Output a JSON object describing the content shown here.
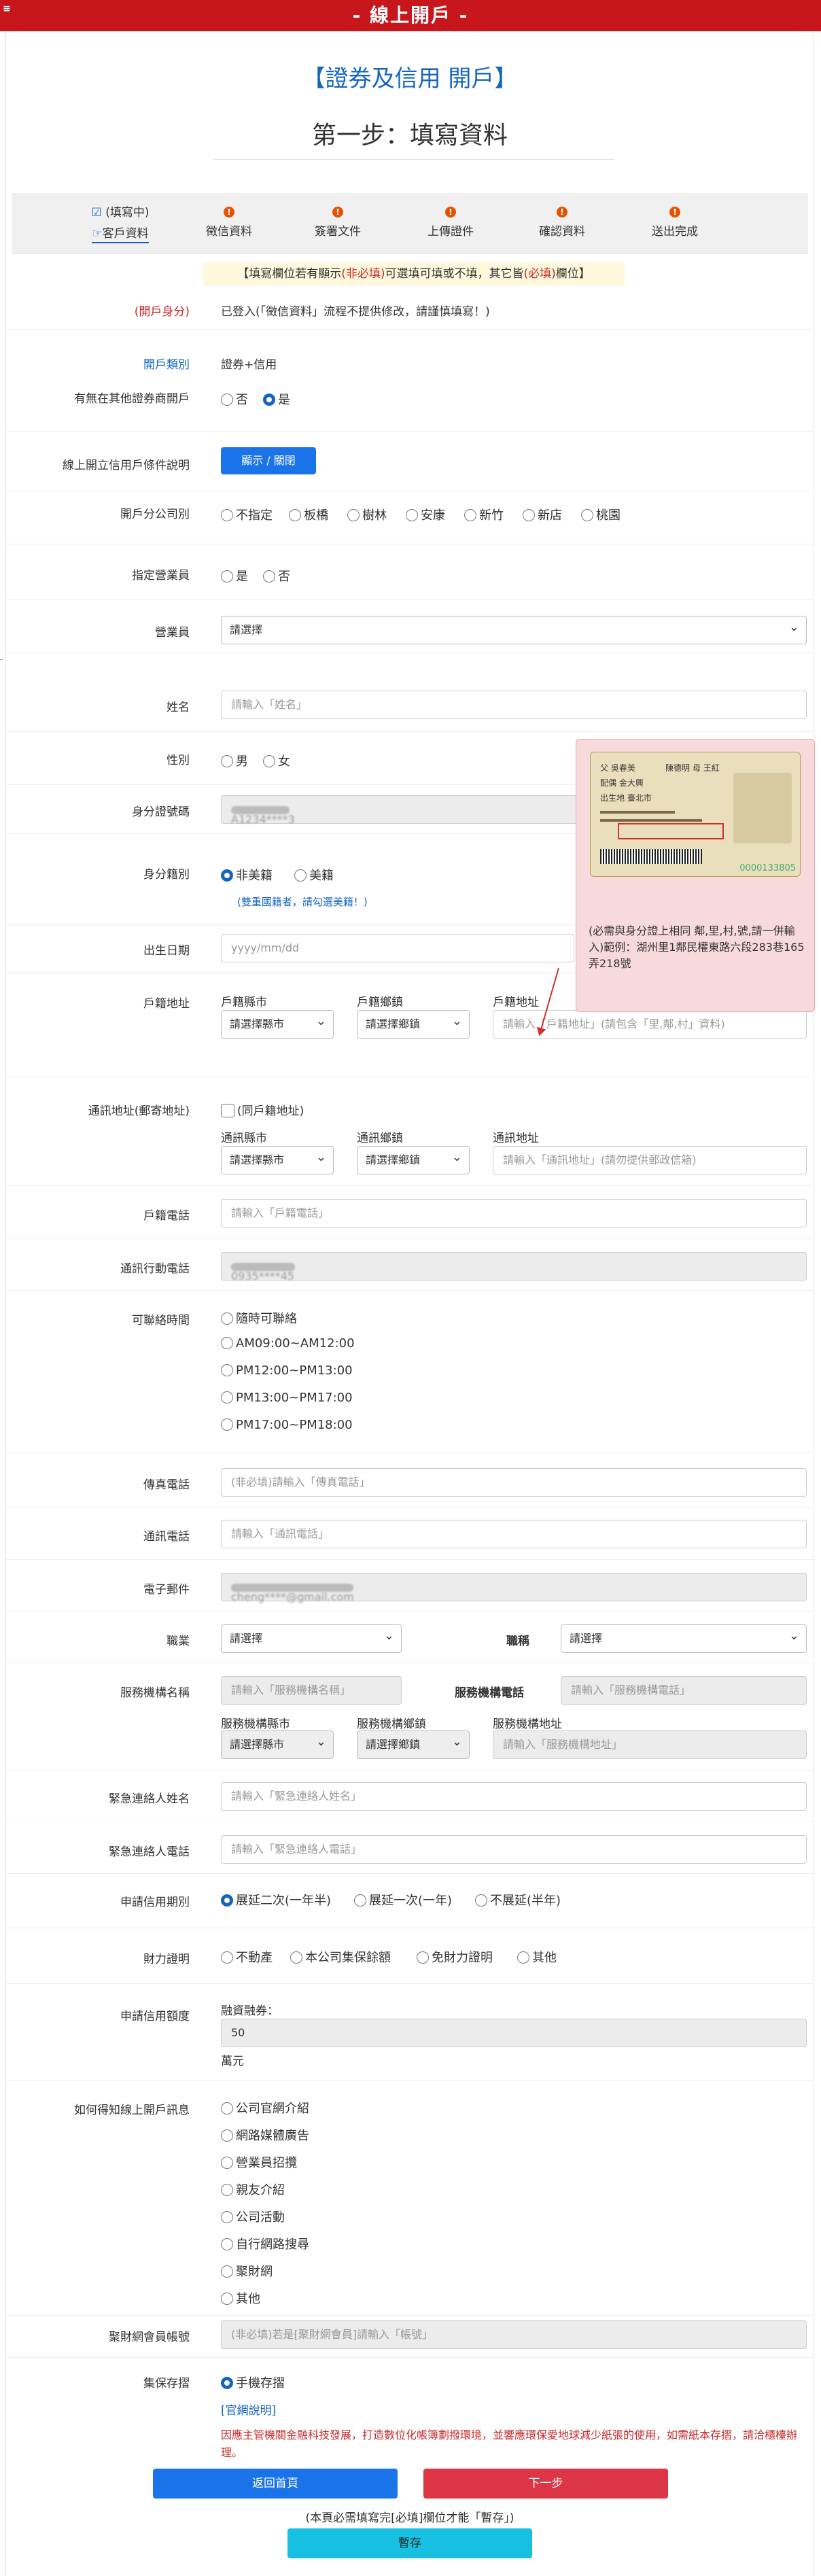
{
  "header": {
    "menu_icon": "≡",
    "title": "- 線上開戶 -"
  },
  "heading": {
    "title": "【證券及信用 開戶】",
    "step_title": "第一步：填寫資料"
  },
  "steps": [
    {
      "status": "(填寫中)",
      "label": "客戶資料",
      "icon": "edit-check"
    },
    {
      "label": "徵信資料",
      "icon": "!"
    },
    {
      "label": "簽署文件",
      "icon": "!"
    },
    {
      "label": "上傳證件",
      "icon": "!"
    },
    {
      "label": "確認資料",
      "icon": "!"
    },
    {
      "label": "送出完成",
      "icon": "!"
    }
  ],
  "notice": {
    "part1": "【填寫欄位若有顯示",
    "optional": "(非必填)",
    "part2": "可選填可填或不填，其它皆",
    "required": "(必填)",
    "part3": "欄位】"
  },
  "identity": {
    "label": "(開戶身分)",
    "value": "已登入(「徵信資料」流程不提供修改，請謹慎填寫！)"
  },
  "account_type": {
    "label": "開戶類別",
    "value": "證券+信用"
  },
  "other_account": {
    "label": "有無在其他證券商開戶",
    "options": [
      "否",
      "是"
    ],
    "selected": "是"
  },
  "credit_conditions": {
    "label": "線上開立信用戶條件說明",
    "button": "顯示 / 關閉"
  },
  "branch": {
    "label": "開戶分公司別",
    "options": [
      "不指定",
      "板橋",
      "樹林",
      "安康",
      "新竹",
      "新店",
      "桃園"
    ]
  },
  "assign_agent": {
    "label": "指定營業員",
    "options": [
      "是",
      "否"
    ]
  },
  "agent": {
    "label": "營業員",
    "value": "請選擇"
  },
  "name": {
    "label": "姓名",
    "placeholder": "請輸入「姓名」"
  },
  "gender": {
    "label": "性別",
    "options": [
      "男",
      "女"
    ]
  },
  "id_number": {
    "label": "身分證號碼",
    "value": "A1234****3"
  },
  "nationality": {
    "label": "身分籍別",
    "options": [
      "非美籍",
      "美籍"
    ],
    "selected": "非美籍",
    "note": "(雙重國籍者，請勾選美籍！)"
  },
  "birthday": {
    "label": "出生日期",
    "placeholder": "yyyy/mm/dd"
  },
  "household": {
    "label": "戶籍地址",
    "county_label": "戶籍縣市",
    "county_value": "請選擇縣市",
    "town_label": "戶籍鄉鎮",
    "town_value": "請選擇鄉鎮",
    "addr_label": "戶籍地址",
    "addr_placeholder": "請輸入「戶籍地址」(請包含「里,鄰,村」資料)"
  },
  "popup": {
    "card_name_label": "姓名",
    "card_name_value": "陳德明",
    "card_spouse": "配偶",
    "card_spouse_value": "金大興",
    "card_father": "父",
    "card_mother": "母",
    "card_father_value": "吳春美",
    "card_mother_value": "王紅",
    "card_birth_label": "出生地",
    "card_birth_value": "臺北市",
    "card_number": "0000133805",
    "text": "(必需與身分證上相同 鄰,里,村,號,請一併輸入)範例：湖州里1鄰民權東路六段283巷165弄218號"
  },
  "mailing": {
    "label": "通訊地址(郵寄地址)",
    "same_label": "(同戶籍地址)",
    "county_label": "通訊縣市",
    "county_value": "請選擇縣市",
    "town_label": "通訊鄉鎮",
    "town_value": "請選擇鄉鎮",
    "addr_label": "通訊地址",
    "addr_placeholder": "請輸入「通訊地址」(請勿提供郵政信箱)"
  },
  "home_phone": {
    "label": "戶籍電話",
    "placeholder": "請輸入「戶籍電話」"
  },
  "mobile": {
    "label": "通訊行動電話",
    "value": "0935****45"
  },
  "contact_time": {
    "label": "可聯絡時間",
    "options": [
      "隨時可聯絡",
      "AM09:00~AM12:00",
      "PM12:00~PM13:00",
      "PM13:00~PM17:00",
      "PM17:00~PM18:00"
    ]
  },
  "fax": {
    "label": "傳真電話",
    "placeholder": "(非必填)請輸入「傳真電話」"
  },
  "mail_phone": {
    "label": "通訊電話",
    "placeholder": "請輸入「通訊電話」"
  },
  "email": {
    "label": "電子郵件",
    "value": "cheng****@gmail.com"
  },
  "job": {
    "label": "職業",
    "value": "請選擇",
    "title_label": "職稱",
    "title_value": "請選擇"
  },
  "org": {
    "name_label": "服務機構名稱",
    "name_placeholder": "請輸入「服務機構名稱」",
    "phone_label": "服務機構電話",
    "phone_placeholder": "請輸入「服務機構電話」",
    "county_label": "服務機構縣市",
    "county_value": "請選擇縣市",
    "town_label": "服務機構鄉鎮",
    "town_value": "請選擇鄉鎮",
    "addr_label": "服務機構地址",
    "addr_placeholder": "請輸入「服務機構地址」"
  },
  "emergency_name": {
    "label": "緊急連絡人姓名",
    "placeholder": "請輸入「緊急連絡人姓名」"
  },
  "emergency_phone": {
    "label": "緊急連絡人電話",
    "placeholder": "請輸入「緊急連絡人電話」"
  },
  "credit_period": {
    "label": "申請信用期別",
    "options": [
      "展延二次(一年半)",
      "展延一次(一年)",
      "不展延(半年)"
    ],
    "selected": "展延二次(一年半)"
  },
  "financial": {
    "label": "財力證明",
    "options": [
      "不動產",
      "本公司集保餘額",
      "免財力證明",
      "其他"
    ]
  },
  "credit_amount": {
    "label": "申請信用額度",
    "sub_label": "融資融券：",
    "value": "50",
    "unit": "萬元"
  },
  "source": {
    "label": "如何得知線上開戶訊息",
    "options": [
      "公司官網介紹",
      "網路媒體廣告",
      "營業員招攬",
      "親友介紹",
      "公司活動",
      "自行網路搜尋",
      "聚財網",
      "其他"
    ]
  },
  "forum_account": {
    "label": "聚財網會員帳號",
    "placeholder": "(非必填)若是[聚財網會員]請輸入「帳號」"
  },
  "custody": {
    "label": "集保存摺",
    "option": "手機存摺",
    "link": "[官網說明]",
    "note": "因應主管機關金融科技發展，打造數位化帳簿劃撥環境，並響應環保愛地球減少紙張的使用，如需紙本存摺，請洽櫃檯辦理。"
  },
  "actions": {
    "back": "返回首頁",
    "next": "下一步",
    "hint": "(本頁必需填寫完[必填]欄位才能「暫存」)",
    "save": "暫存"
  }
}
